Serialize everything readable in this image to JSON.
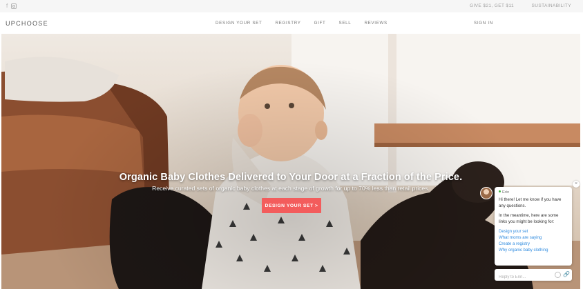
{
  "topbar": {
    "social_icons": [
      "facebook-icon",
      "instagram-icon"
    ],
    "facebook_glyph": "f",
    "promo_link": "GIVE $21, GET $11",
    "sustainability_link": "SUSTAINABILITY"
  },
  "header": {
    "logo": "UPCHOOSE",
    "nav": [
      {
        "label": "DESIGN YOUR SET"
      },
      {
        "label": "REGISTRY"
      },
      {
        "label": "GIFT"
      },
      {
        "label": "SELL"
      },
      {
        "label": "REVIEWS"
      }
    ],
    "signin": "SIGN IN"
  },
  "hero": {
    "headline": "Organic Baby Clothes Delivered to Your Door at a Fraction of the Price.",
    "subheadline": "Receive curated sets of organic baby clothes at each stage of growth for up to 70% less than retail prices.",
    "cta": "DESIGN YOUR SET >"
  },
  "chat": {
    "close_glyph": "×",
    "agent_name": "Erin",
    "greeting": "Hi there! Let me know if you have any questions.",
    "intro": "In the meantime, here are some links you might be looking for:",
    "links": [
      {
        "label": "Design your set"
      },
      {
        "label": "What moms are saying"
      },
      {
        "label": "Create a registry"
      },
      {
        "label": "Why organic baby clothing"
      }
    ],
    "input_placeholder": "Reply to Erin...",
    "attach_glyph": "🔗"
  },
  "colors": {
    "accent": "#f35c5c",
    "link": "#2f8bdf",
    "topbar_bg": "#f6f6f6",
    "online_dot": "#42b842"
  }
}
